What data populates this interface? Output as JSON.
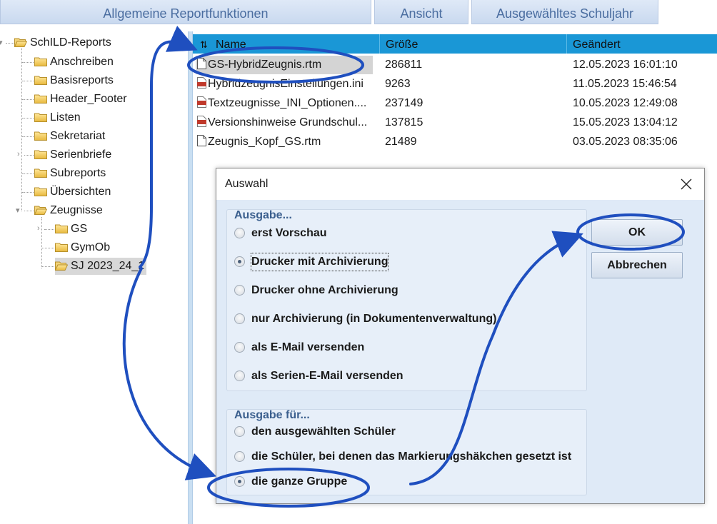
{
  "tabs": [
    {
      "label": "Allgemeine Reportfunktionen"
    },
    {
      "label": "Ansicht"
    },
    {
      "label": "Ausgewähltes Schuljahr"
    }
  ],
  "tree": {
    "root": "SchILD-Reports",
    "items": [
      {
        "label": "Anschreiben"
      },
      {
        "label": "Basisreports"
      },
      {
        "label": "Header_Footer"
      },
      {
        "label": "Listen"
      },
      {
        "label": "Sekretariat"
      },
      {
        "label": "Serienbriefe"
      },
      {
        "label": "Subreports"
      },
      {
        "label": "Übersichten"
      },
      {
        "label": "Zeugnisse"
      }
    ],
    "sub_items": [
      {
        "label": "GS"
      },
      {
        "label": "GymOb"
      },
      {
        "label": "SJ 2023_24_1"
      }
    ]
  },
  "filelist": {
    "columns": [
      "Name",
      "Größe",
      "Geändert"
    ],
    "rows": [
      {
        "name": "GS-HybridZeugnis.rtm",
        "size": "286811",
        "date": "12.05.2023 16:01:10",
        "icon": "rtm-file-icon"
      },
      {
        "name": "HybridzeugnisEinstellungen.ini",
        "size": "9263",
        "date": "11.05.2023 15:46:54",
        "icon": "ini-file-icon"
      },
      {
        "name": "Textzeugnisse_INI_Optionen....",
        "size": "237149",
        "date": "10.05.2023 12:49:08",
        "icon": "pdf-file-icon"
      },
      {
        "name": "Versionshinweise Grundschul...",
        "size": "137815",
        "date": "15.05.2023 13:04:12",
        "icon": "pdf-file-icon"
      },
      {
        "name": "Zeugnis_Kopf_GS.rtm",
        "size": "21489",
        "date": "03.05.2023 08:35:06",
        "icon": "rtm-file-icon"
      }
    ]
  },
  "dialog": {
    "title": "Auswahl",
    "group1": {
      "title": "Ausgabe...",
      "options": [
        {
          "label": "erst Vorschau",
          "checked": false
        },
        {
          "label": "Drucker mit Archivierung",
          "checked": true
        },
        {
          "label": "Drucker ohne Archivierung",
          "checked": false
        },
        {
          "label": "nur Archivierung (in Dokumentenverwaltung)",
          "checked": false
        },
        {
          "label": "als E-Mail versenden",
          "checked": false
        },
        {
          "label": "als Serien-E-Mail versenden",
          "checked": false
        }
      ]
    },
    "group2": {
      "title": "Ausgabe für...",
      "options": [
        {
          "label": "den ausgewählten Schüler",
          "checked": false
        },
        {
          "label": "die Schüler, bei denen das Markierungshäkchen gesetzt ist",
          "checked": false
        },
        {
          "label": "die ganze Gruppe",
          "checked": true
        }
      ]
    },
    "ok_label": "OK",
    "cancel_label": "Abbrechen"
  },
  "colors": {
    "header_blue": "#1a97d6",
    "annotation_blue": "#1f4fbf",
    "dialog_bg": "#dfeaf7"
  }
}
